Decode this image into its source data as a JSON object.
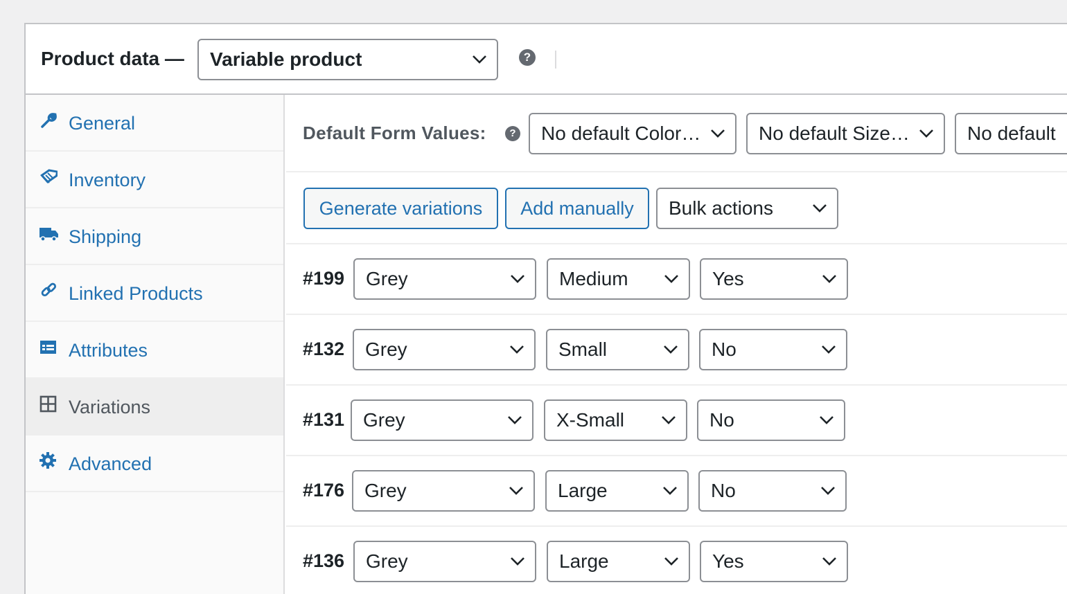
{
  "header": {
    "title": "Product data —",
    "product_type": "Variable product",
    "help": "?"
  },
  "sidebar": {
    "items": [
      {
        "label": "General",
        "icon": "wrench-icon"
      },
      {
        "label": "Inventory",
        "icon": "tag-icon"
      },
      {
        "label": "Shipping",
        "icon": "truck-icon"
      },
      {
        "label": "Linked Products",
        "icon": "link-icon"
      },
      {
        "label": "Attributes",
        "icon": "list-view-icon"
      },
      {
        "label": "Variations",
        "icon": "grid-icon",
        "active": true
      },
      {
        "label": "Advanced",
        "icon": "gear-icon"
      }
    ]
  },
  "defaults": {
    "label": "Default Form Values:",
    "help": "?",
    "color": "No default Color…",
    "size": "No default Size…",
    "third": "No default"
  },
  "toolbar": {
    "generate": "Generate variations",
    "add": "Add manually",
    "bulk": "Bulk actions"
  },
  "variations": [
    {
      "id": "#199",
      "color": "Grey",
      "size": "Medium",
      "flag": "Yes"
    },
    {
      "id": "#132",
      "color": "Grey",
      "size": "Small",
      "flag": "No"
    },
    {
      "id": "#131",
      "color": "Grey",
      "size": "X-Small",
      "flag": "No"
    },
    {
      "id": "#176",
      "color": "Grey",
      "size": "Large",
      "flag": "No"
    },
    {
      "id": "#136",
      "color": "Grey",
      "size": "Large",
      "flag": "Yes"
    }
  ],
  "colors": {
    "link": "#2271b1",
    "border": "#8c8f94",
    "text": "#1d2327"
  }
}
